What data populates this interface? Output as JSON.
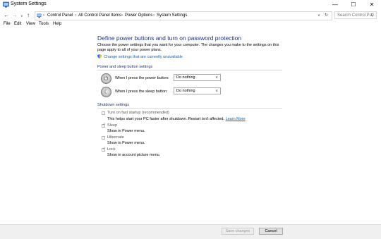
{
  "window": {
    "title": "System Settings",
    "minimize_icon": "minimize-icon",
    "maximize_icon": "maximize-icon",
    "close_icon": "close-icon"
  },
  "addressbar": {
    "crumbs": [
      "Control Panel",
      "All Control Panel Items",
      "Power Options",
      "System Settings"
    ],
    "search_placeholder": "Search Control Pa..."
  },
  "menubar": {
    "items": [
      "File",
      "Edit",
      "View",
      "Tools",
      "Help"
    ]
  },
  "main": {
    "heading": "Define power buttons and turn on password protection",
    "description": "Choose the power settings that you want for your computer. The changes you make to the settings on this page apply to all of your power plans.",
    "change_link": "Change settings that are currently unavailable",
    "power_section": "Power and sleep button settings",
    "power_button_label": "When I press the power button:",
    "power_button_value": "Do nothing",
    "sleep_button_label": "When I press the sleep button:",
    "sleep_button_value": "Do nothing",
    "shutdown_section": "Shutdown settings",
    "options": [
      {
        "label": "Turn on fast startup (recommended)",
        "desc": "This helps start your PC faster after shutdown. Restart isn't affected.",
        "link": "Learn More",
        "checked": false
      },
      {
        "label": "Sleep",
        "desc": "Show in Power menu.",
        "checked": true
      },
      {
        "label": "Hibernate",
        "desc": "Show in Power menu.",
        "checked": false
      },
      {
        "label": "Lock",
        "desc": "Show in account picture menu.",
        "checked": true
      }
    ]
  },
  "footer": {
    "save_label": "Save changes",
    "cancel_label": "Cancel"
  }
}
